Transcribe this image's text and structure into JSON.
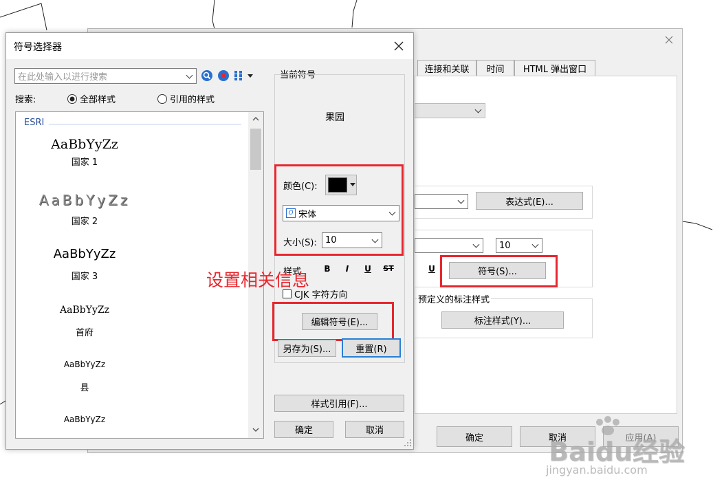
{
  "symbol_selector": {
    "title": "符号选择器",
    "search_placeholder": "在此处输入以进行搜索",
    "search_label": "搜索:",
    "radio_all": "全部样式",
    "radio_ref": "引用的样式",
    "group_label": "ESRI",
    "items": [
      {
        "sample": "AaBbYyZz",
        "name": "国家 1"
      },
      {
        "sample": "AaBbYyZz",
        "name": "国家 2"
      },
      {
        "sample": "AaBbYyZz",
        "name": "国家 3"
      },
      {
        "sample": "AaBbYyZz",
        "name": "首府"
      },
      {
        "sample": "AaBbYyZz",
        "name": "县"
      },
      {
        "sample": "AaBbYyZz",
        "name": ""
      }
    ],
    "current_symbol_label": "当前符号",
    "preview_text": "果园",
    "color_label": "颜色(C):",
    "font_value": "宋体",
    "size_label": "大小(S):",
    "size_value": "10",
    "style_label": "样式",
    "bold": "B",
    "italic": "I",
    "underline": "U",
    "strike": "ST",
    "cjk_label": "CJK 字符方向",
    "edit_symbol": "编辑符号(E)...",
    "save_as": "另存为(S)...",
    "reset": "重置(R)",
    "style_ref": "样式引用(F)...",
    "ok": "确定",
    "cancel": "取消",
    "color_swatch": "#000000"
  },
  "annotation": "设置相关信息",
  "annotation_color": "#e8262d",
  "bg_dialog": {
    "tabs": [
      "连接和关联",
      "时间",
      "HTML 弹出窗口"
    ],
    "expression_button": "表达式(E)...",
    "size_value": "10",
    "underline": "U",
    "symbol_button": "符号(S)...",
    "predefined_label": "预定义的标注样式",
    "label_style_button": "标注样式(Y)...",
    "ok": "确定",
    "cancel": "取消",
    "apply": "应用(A)"
  },
  "watermark": {
    "logo": "Baidu经验",
    "url": "jingyan.baidu.com"
  }
}
